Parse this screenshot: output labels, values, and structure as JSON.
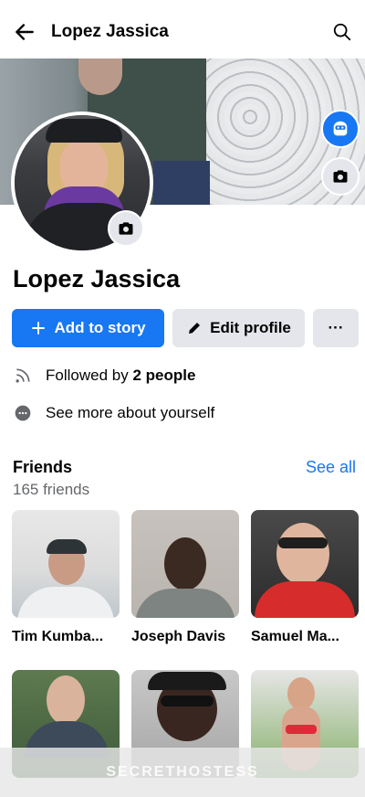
{
  "header": {
    "title": "Lopez Jassica"
  },
  "profile": {
    "name": "Lopez Jassica"
  },
  "actions": {
    "add_story_label": "Add to story",
    "edit_profile_label": "Edit profile",
    "more_label": "···"
  },
  "info": {
    "followed_prefix": "Followed by ",
    "followed_count": "2 people",
    "see_more_label": "See more about yourself"
  },
  "friends": {
    "title": "Friends",
    "count": "165 friends",
    "see_all_label": "See all",
    "items": [
      {
        "name": "Tim Kumba..."
      },
      {
        "name": "Joseph Davis"
      },
      {
        "name": "Samuel Ma..."
      },
      {
        "name": ""
      },
      {
        "name": ""
      },
      {
        "name": ""
      }
    ]
  },
  "watermark": "SECRETHOSTESS",
  "colors": {
    "accent": "#1877f2",
    "secondary_button": "#e4e6eb",
    "muted_text": "#65676b"
  },
  "icons": {
    "back": "arrow-left-icon",
    "search": "search-icon",
    "avatar_editor": "avatar-face-icon",
    "camera": "camera-icon",
    "plus": "plus-icon",
    "pencil": "pencil-icon",
    "rss": "rss-icon",
    "more": "more-dots-icon"
  }
}
